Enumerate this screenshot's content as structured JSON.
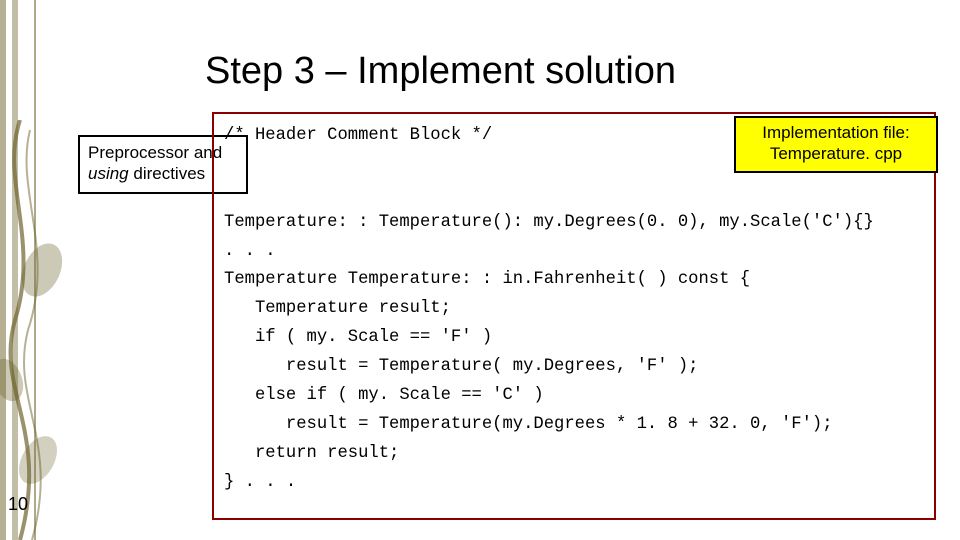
{
  "title": "Step 3 – Implement solution",
  "preprocessor_box": {
    "line1": "Preprocessor and",
    "line2_prefix": "using",
    "line2_rest": " directives"
  },
  "file_label": {
    "line1": "Implementation file:",
    "line2": "Temperature. cpp"
  },
  "code": "/* Header Comment Block */\n\n\nTemperature: : Temperature(): my.Degrees(0. 0), my.Scale('C'){}\n. . .\nTemperature Temperature: : in.Fahrenheit( ) const {\n   Temperature result;\n   if ( my. Scale == 'F' )\n      result = Temperature( my.Degrees, 'F' );\n   else if ( my. Scale == 'C' )\n      result = Temperature(my.Degrees * 1. 8 + 32. 0, 'F');\n   return result;\n} . . .",
  "page_number": "10"
}
